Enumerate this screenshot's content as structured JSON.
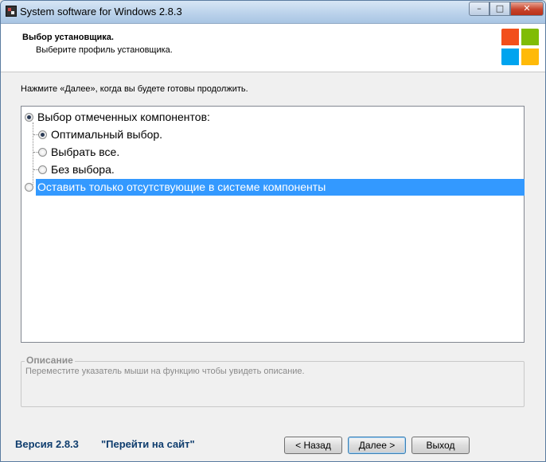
{
  "window": {
    "title": "System software for Windows 2.8.3",
    "minimize_glyph": "–",
    "maximize_glyph": "□",
    "close_glyph": "✕"
  },
  "header": {
    "title": "Выбор установщика.",
    "subtitle": "Выберите профиль установщика."
  },
  "logo": {
    "icon": "windows-logo",
    "colors": [
      "#f24f1c",
      "#80bc06",
      "#00a4ef",
      "#ffba08"
    ]
  },
  "prompt": "Нажмите «Далее», когда вы будете готовы продолжить.",
  "tree": {
    "items": [
      {
        "label": "Выбор отмеченных компонентов:",
        "checked": true
      },
      {
        "label": "Оптимальный выбор.",
        "checked": true
      },
      {
        "label": "Выбрать все.",
        "checked": false
      },
      {
        "label": "Без выбора.",
        "checked": false
      },
      {
        "label": "Оставить только отсутствующие в системе компоненты",
        "checked": false,
        "selected": true
      }
    ],
    "selection_color": "#3399ff"
  },
  "description": {
    "title": "Описание",
    "text": "Переместите указатель мыши на функцию чтобы увидеть описание."
  },
  "footer": {
    "version": "Версия 2.8.3",
    "site_link": "\"Перейти на сайт\"",
    "back_label": "< Назад",
    "next_label": "Далее >",
    "exit_label": "Выход",
    "link_color": "#0f3d6e"
  }
}
